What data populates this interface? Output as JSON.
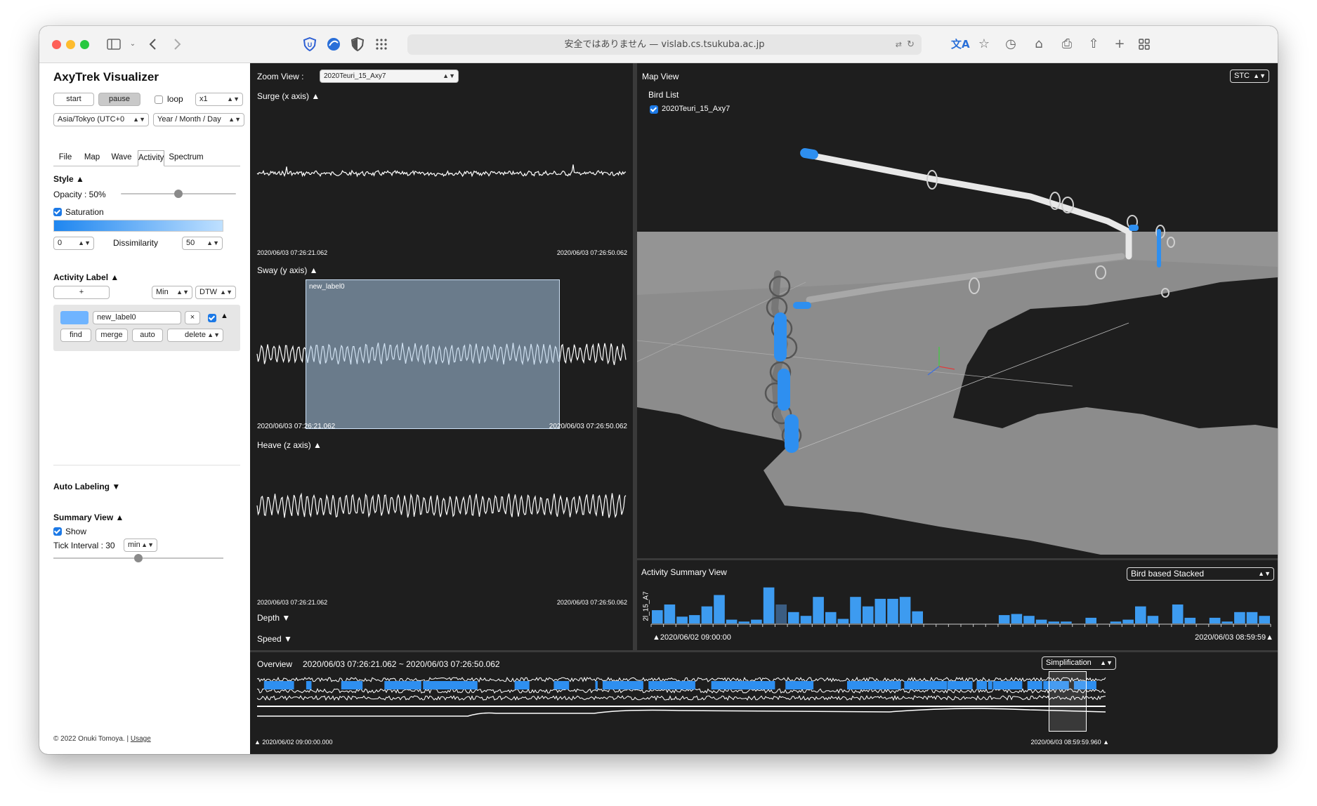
{
  "browser": {
    "url_text": "安全ではありません — vislab.cs.tsukuba.ac.jp",
    "icons": [
      "sidebar-icon",
      "chevron-down-icon",
      "back-icon",
      "forward-icon",
      "shield-icon",
      "app-icon",
      "privacy-icon",
      "grid-icon",
      "translate-page-icon",
      "reload-icon",
      "translate-icon",
      "star-icon",
      "history-icon",
      "home-icon",
      "print-icon",
      "share-icon",
      "new-tab-icon",
      "tabs-overview-icon"
    ]
  },
  "sidebar": {
    "app_title": "AxyTrek Visualizer",
    "start_label": "start",
    "pause_label": "pause",
    "loop_label": "loop",
    "speed_value": "x1",
    "timezone_value": "Asia/Tokyo (UTC+0",
    "date_format_value": "Year / Month / Day",
    "tabs": [
      "File",
      "Map",
      "Wave",
      "Activity",
      "Spectrum"
    ],
    "active_tab": "Activity",
    "style_heading": "Style ▲",
    "opacity_label": "Opacity : 50%",
    "opacity_value": 0.5,
    "saturation_label": "Saturation",
    "dissim_min": "0",
    "dissim_label": "Dissimilarity",
    "dissim_max": "50",
    "activity_label_heading": "Activity Label ▲",
    "add_label": "+",
    "agg_value": "Min",
    "method_value": "DTW",
    "label_name": "new_label0",
    "label_color": "#6fb4ff",
    "clear_label": "×",
    "find_label": "find",
    "merge_label": "merge",
    "auto_label": "auto",
    "delete_label": "delete",
    "auto_labeling_heading": "Auto Labeling ▼",
    "summary_heading": "Summary View ▲",
    "show_label": "Show",
    "tick_interval_label": "Tick Interval : 30",
    "tick_unit_value": "min",
    "tick_slider_value": 0.5,
    "footer_text": "© 2022 Onuki Tomoya. | ",
    "footer_link": "Usage"
  },
  "zoom_view": {
    "title": "Zoom View :",
    "bird_value": "2020Teuri_15_Axy7",
    "surge_title": "Surge (x axis) ▲",
    "sway_title": "Sway (y axis) ▲",
    "heave_title": "Heave (z axis) ▲",
    "depth_title": "Depth ▼",
    "speed_title": "Speed ▼",
    "start_time": "2020/06/03 07:26:21.062",
    "end_time": "2020/06/03 07:26:50.062",
    "selection_label": "new_label0"
  },
  "map_view": {
    "title": "Map View",
    "mode_value": "STC",
    "bird_list_title": "Bird List",
    "bird_name": "2020Teuri_15_Axy7"
  },
  "summary_view": {
    "title": "Activity Summary View",
    "mode_value": "Bird based Stacked",
    "y_label": "2l_15_A7",
    "start_label": "▲2020/06/02 09:00:00",
    "end_label": "2020/06/03 08:59:59▲",
    "bar_color": "#3d9bf0",
    "bar_values": [
      0.35,
      0.5,
      0.18,
      0.22,
      0.45,
      0.75,
      0.1,
      0.05,
      0.1,
      0.95,
      0.5,
      0.3,
      0.2,
      0.7,
      0.3,
      0.12,
      0.7,
      0.45,
      0.65,
      0.65,
      0.7,
      0.32,
      0,
      0,
      0,
      0,
      0,
      0,
      0.22,
      0.25,
      0.2,
      0.1,
      0.05,
      0.05,
      0,
      0.15,
      0,
      0.05,
      0.1,
      0.45,
      0.2,
      0,
      0.5,
      0.15,
      0,
      0.15,
      0.05,
      0.3,
      0.3,
      0.2
    ],
    "dark_bar_index": 10
  },
  "overview": {
    "title": "Overview",
    "range_text": "2020/06/03 07:26:21.062 ~ 2020/06/03 07:26:50.062",
    "mode_value": "Simplification",
    "start_label": "▲ 2020/06/02 09:00:00.000",
    "end_label": "2020/06/03 08:59:59.960 ▲"
  }
}
